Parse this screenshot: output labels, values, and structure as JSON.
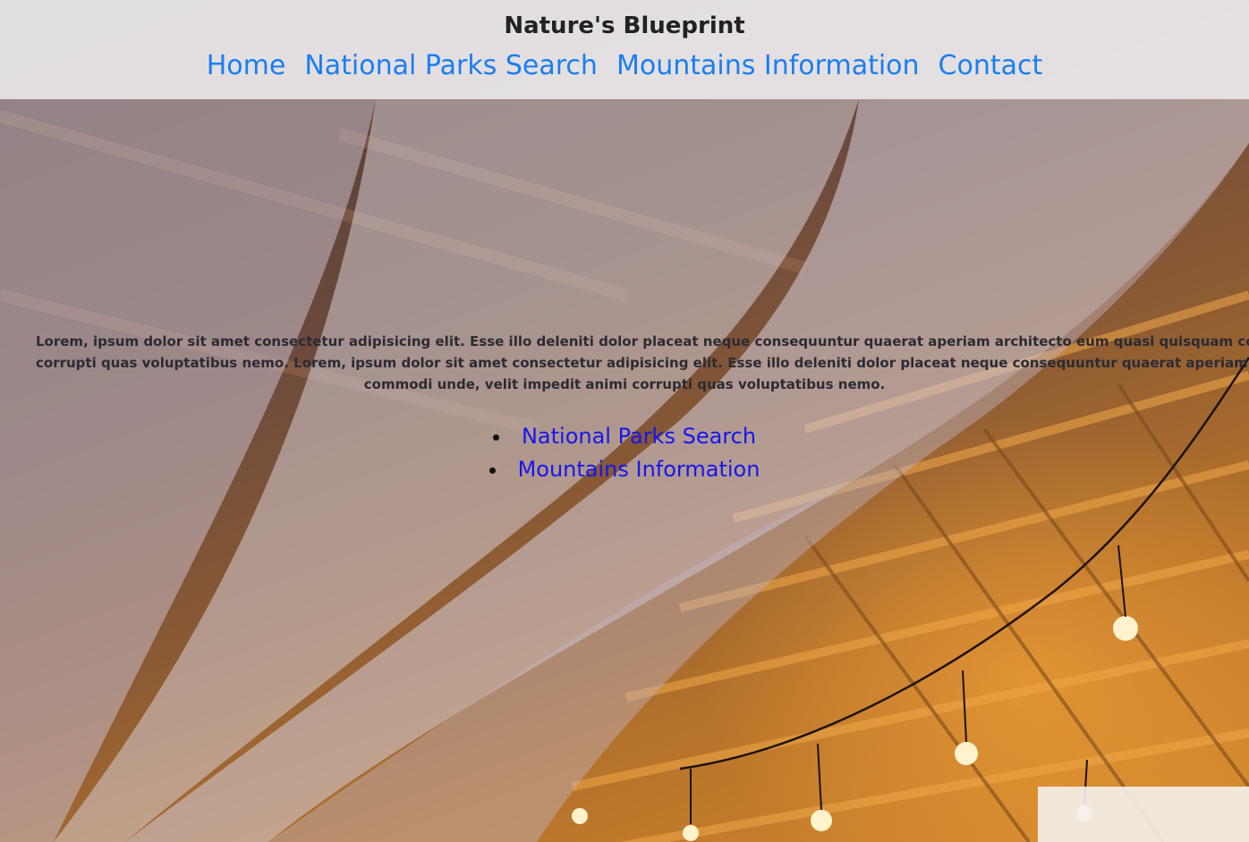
{
  "header": {
    "site_title": "Nature's Blueprint",
    "nav": [
      {
        "label": "Home"
      },
      {
        "label": "National Parks Search"
      },
      {
        "label": "Mountains Information"
      },
      {
        "label": "Contact"
      }
    ]
  },
  "main": {
    "paragraph_line_1": "Lorem, ipsum dolor sit amet consectetur adipisicing elit. Esse illo deleniti dolor placeat neque consequuntur quaerat aperiam architecto eum quasi quisquam commodi unde, velit impedit animi corrupti",
    "paragraph_line_2": "corrupti quas voluptatibus nemo. Lorem, ipsum dolor sit amet consectetur adipisicing elit. Esse illo deleniti dolor placeat neque consequuntur quaerat aperiam architecto eum quasi quisquam",
    "paragraph_line_3": "commodi unde, velit impedit animi corrupti quas voluptatibus nemo.",
    "links": [
      {
        "label": "National Parks Search"
      },
      {
        "label": "Mountains Information"
      }
    ]
  },
  "colors": {
    "nav_link": "#1a7ef2",
    "list_link": "#1616ef",
    "header_bg": "#eeecee"
  }
}
